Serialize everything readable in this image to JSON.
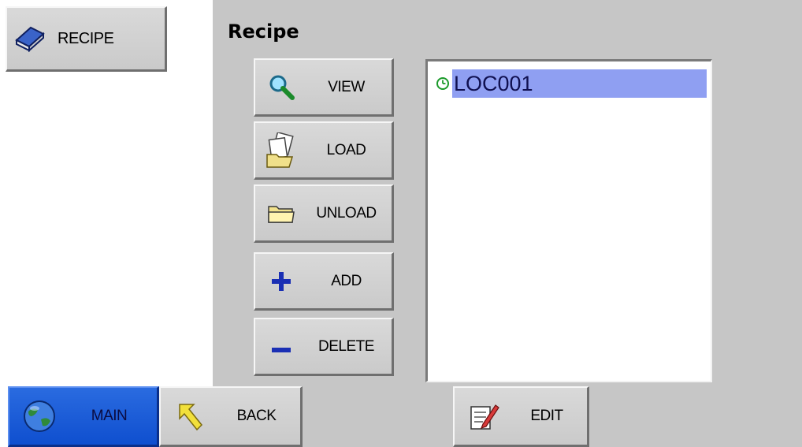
{
  "top_button": {
    "label": "RECIPE",
    "icon": "book-icon"
  },
  "panel": {
    "title": "Recipe",
    "actions": [
      {
        "label": "VIEW",
        "icon": "magnifier-icon"
      },
      {
        "label": "LOAD",
        "icon": "load-files-icon"
      },
      {
        "label": "UNLOAD",
        "icon": "folder-icon"
      },
      {
        "label": "ADD",
        "icon": "plus-icon"
      },
      {
        "label": "DELETE",
        "icon": "minus-icon"
      }
    ],
    "recipes": [
      {
        "name": "LOC001",
        "icon": "clock-icon",
        "selected": true
      }
    ]
  },
  "nav": {
    "main_label": "MAIN",
    "back_label": "BACK",
    "edit_label": "EDIT"
  },
  "colors": {
    "panel_bg": "#c6c6c6",
    "selection": "#8f9ff2",
    "main_button": "#1a5cd8",
    "plus_minus": "#1a2fb4"
  }
}
